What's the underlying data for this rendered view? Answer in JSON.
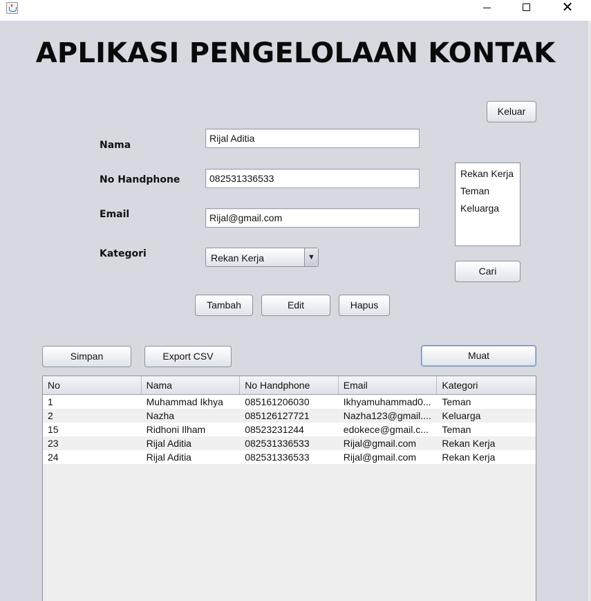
{
  "window": {
    "title": "",
    "minimize_icon": "minimize-icon",
    "maximize_icon": "maximize-icon",
    "close_icon": "close-icon",
    "close_glyph": "✕"
  },
  "header": {
    "title": "APLIKASI PENGELOLAAN KONTAK"
  },
  "form": {
    "name_label": "Nama",
    "name_value": "Rijal Aditia",
    "phone_label": "No Handphone",
    "phone_value": "082531336533",
    "email_label": "Email",
    "email_value": "Rijal@gmail.com",
    "category_label": "Kategori",
    "category_selected": "Rekan Kerja",
    "category_arrow": "▼"
  },
  "buttons": {
    "exit": "Keluar",
    "search": "Cari",
    "add": "Tambah",
    "edit": "Edit",
    "delete": "Hapus",
    "save": "Simpan",
    "export_csv": "Export CSV",
    "load": "Muat"
  },
  "category_list": [
    "Rekan Kerja",
    "Teman",
    "Keluarga"
  ],
  "table": {
    "columns": [
      "No",
      "Nama",
      "No Handphone",
      "Email",
      "Kategori"
    ],
    "rows": [
      [
        "1",
        "Muhammad Ikhya",
        "085161206030",
        "Ikhyamuhammad0...",
        "Teman"
      ],
      [
        "2",
        "Nazha",
        "085126127721",
        "Nazha123@gmail....",
        "Keluarga"
      ],
      [
        "15",
        "Ridhoni Ilham",
        "08523231244",
        "edokece@gmail.c...",
        "Teman"
      ],
      [
        "23",
        "Rijal Aditia",
        "082531336533",
        "Rijal@gmail.com",
        "Rekan Kerja"
      ],
      [
        "24",
        "Rijal Aditia",
        "082531336533",
        "Rijal@gmail.com",
        "Rekan Kerja"
      ]
    ]
  },
  "colors": {
    "window_background": "#d6d9e0",
    "title_text": "#0a0a0a",
    "table_background": "#eeeeee"
  }
}
